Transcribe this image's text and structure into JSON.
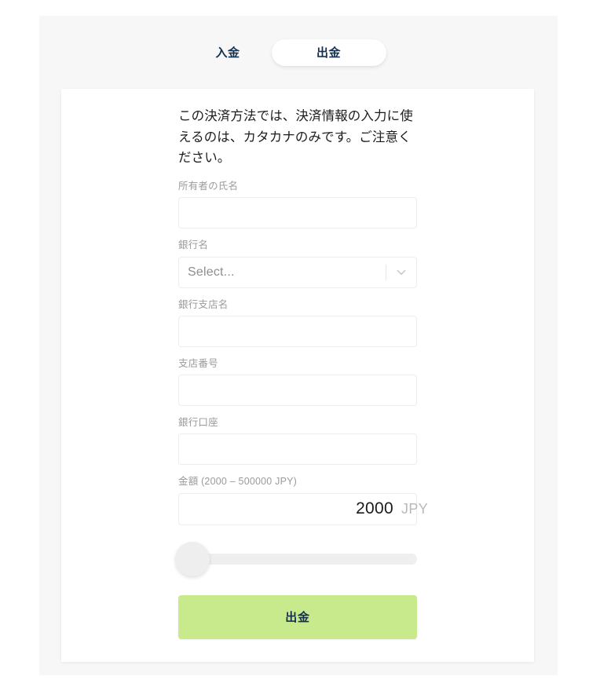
{
  "tabs": {
    "deposit_label": "入金",
    "withdraw_label": "出金",
    "active": "出金"
  },
  "form": {
    "notice": "この決済方法では、決済情報の入力に使えるのは、カタカナのみです。ご注意ください。",
    "fields": [
      {
        "label": "所有者の氏名",
        "value": "",
        "placeholder": ""
      },
      {
        "label": "銀行名",
        "value": "Select...",
        "placeholder": "Select..."
      },
      {
        "label": "銀行支店名",
        "value": "",
        "placeholder": ""
      },
      {
        "label": "支店番号",
        "value": "",
        "placeholder": ""
      },
      {
        "label": "銀行口座",
        "value": "",
        "placeholder": ""
      }
    ],
    "amount": {
      "label": "金額 (2000 – 500000 JPY)",
      "value": "2000",
      "currency": "JPY",
      "min": 2000,
      "max": 500000
    },
    "slider": {
      "value": 2000,
      "min": 2000,
      "max": 500000,
      "percent": 0
    },
    "submit_label": "出金"
  },
  "colors": {
    "accent_green": "#c8e98c",
    "text_navy": "#13304f",
    "label_gray": "#9b9b9b",
    "panel_gray": "#f7f7f7"
  },
  "icons": {
    "chevron_down": "chevron-down-icon"
  }
}
